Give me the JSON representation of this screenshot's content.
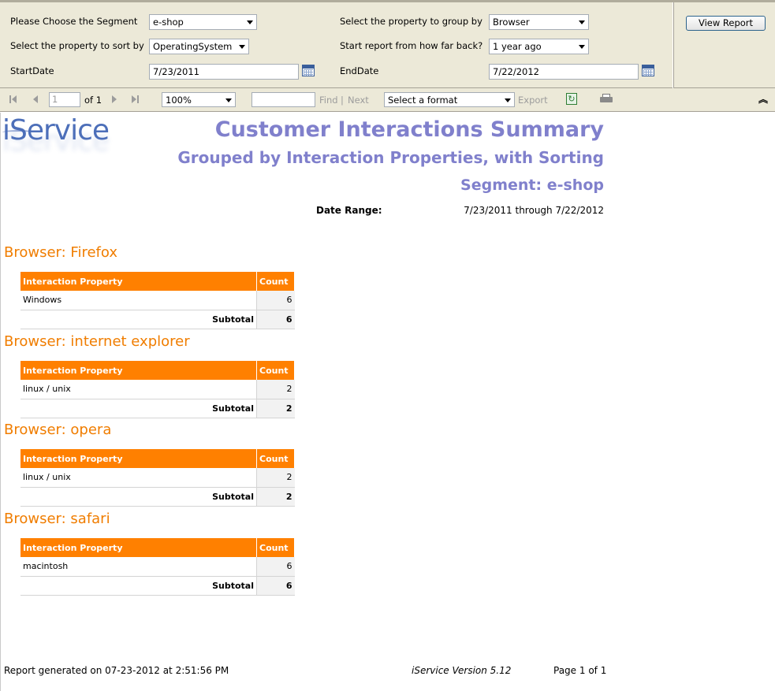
{
  "params": {
    "segment_label": "Please Choose the Segment",
    "segment_value": "e-shop",
    "sort_label": "Select the property to sort by",
    "sort_value": "OperatingSystem",
    "start_label": "StartDate",
    "start_value": "7/23/2011",
    "group_label": "Select the property to group by",
    "group_value": "Browser",
    "back_label": "Start report from how far back?",
    "back_value": "1 year ago",
    "end_label": "EndDate",
    "end_value": "7/22/2012",
    "view_button": "View Report"
  },
  "toolbar": {
    "page_value": "1",
    "of_label": "of 1",
    "zoom_value": "100%",
    "find_label": "Find",
    "separator": "|",
    "next_label": "Next",
    "format_value": "Select a format",
    "export_label": "Export"
  },
  "report": {
    "logo": "iService",
    "title": "Customer Interactions Summary",
    "subtitle": "Grouped by Interaction Properties, with Sorting",
    "segment_line": "Segment: e-shop",
    "date_range_label": "Date Range:",
    "date_range_value": "7/23/2011 through 7/22/2012",
    "col_property": "Interaction Property",
    "col_count": "Count",
    "subtotal_label": "Subtotal",
    "groups": [
      {
        "heading": "Browser: Firefox",
        "property": "Windows",
        "count": "6",
        "subtotal": "6"
      },
      {
        "heading": "Browser: internet explorer",
        "property": "linux / unix",
        "count": "2",
        "subtotal": "2"
      },
      {
        "heading": "Browser: opera",
        "property": "linux / unix",
        "count": "2",
        "subtotal": "2"
      },
      {
        "heading": "Browser: safari",
        "property": "macintosh",
        "count": "6",
        "subtotal": "6"
      }
    ],
    "footer_generated": "Report generated on 07-23-2012 at 2:51:56 PM",
    "footer_version": "iService Version 5.12",
    "footer_page": "Page 1 of 1"
  }
}
